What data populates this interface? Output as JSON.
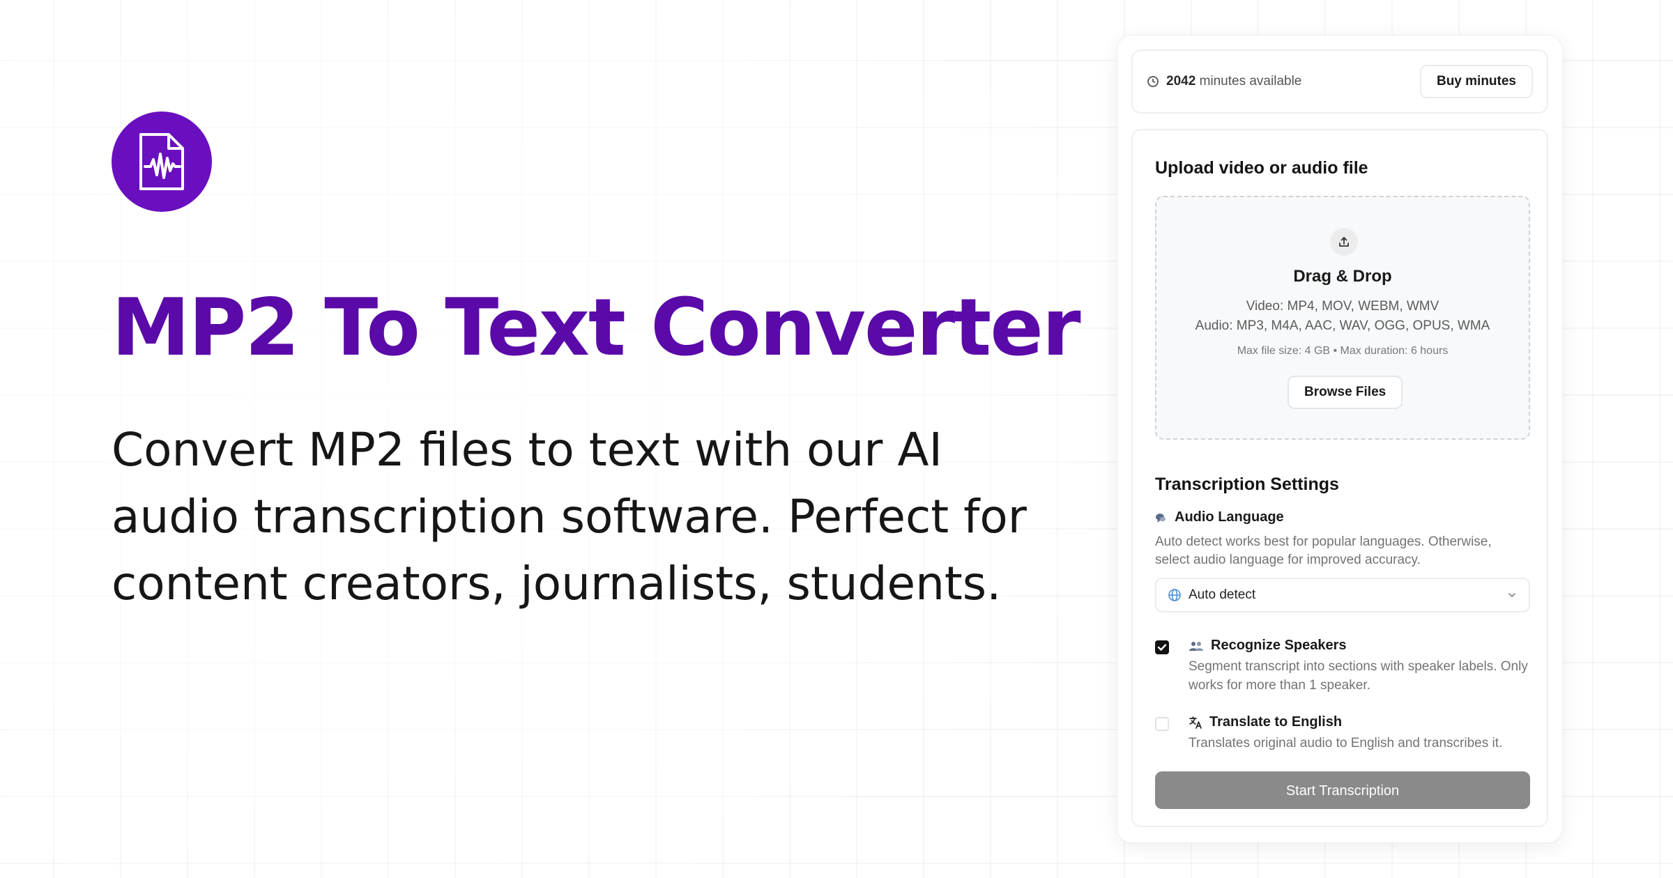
{
  "hero": {
    "logo_icon": "audio-file-icon",
    "title": "MP2 To Text Converter",
    "subtitle": "Convert MP2 files to text with our AI audio transcription software. Perfect for content creators, journalists, students.",
    "accent_color": "#5a0aa8"
  },
  "minutes": {
    "icon": "clock-icon",
    "count": "2042",
    "label": "minutes available",
    "buy_label": "Buy minutes"
  },
  "upload": {
    "title": "Upload video or audio file",
    "icon": "upload-icon",
    "drop_title": "Drag & Drop",
    "video_formats": "Video: MP4, MOV, WEBM, WMV",
    "audio_formats": "Audio: MP3, M4A, AAC, WAV, OGG, OPUS, WMA",
    "limits": "Max file size: 4 GB • Max duration: 6 hours",
    "browse_label": "Browse Files"
  },
  "settings": {
    "title": "Transcription Settings",
    "language": {
      "icon": "speech-bubble-icon",
      "label": "Audio Language",
      "description": "Auto detect works best for popular languages. Otherwise, select audio language for improved accuracy.",
      "select_icon": "globe-icon",
      "selected": "Auto detect"
    },
    "speakers": {
      "checked": true,
      "icon": "people-icon",
      "label": "Recognize Speakers",
      "description": "Segment transcript into sections with speaker labels. Only works for more than 1 speaker."
    },
    "translate": {
      "checked": false,
      "icon": "translate-icon",
      "label": "Translate to English",
      "description": "Translates original audio to English and transcribes it."
    },
    "start_label": "Start Transcription"
  }
}
